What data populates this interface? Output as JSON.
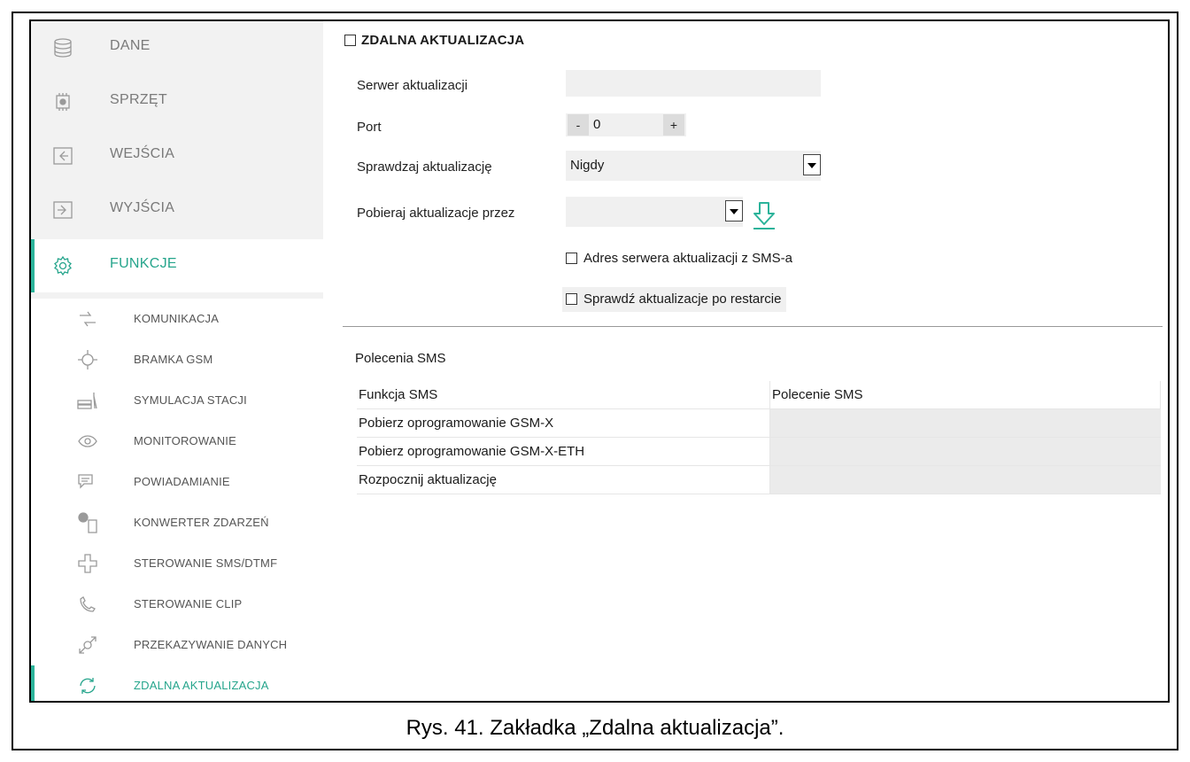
{
  "sidebar": {
    "main_items": [
      {
        "label": "DANE",
        "icon": "database-icon"
      },
      {
        "label": "SPRZĘT",
        "icon": "chip-icon"
      },
      {
        "label": "WEJŚCIA",
        "icon": "input-icon"
      },
      {
        "label": "WYJŚCIA",
        "icon": "output-icon"
      },
      {
        "label": "FUNKCJE",
        "icon": "gear-icon"
      }
    ],
    "sub_items": [
      {
        "label": "KOMUNIKACJA",
        "icon": "arrows-icon"
      },
      {
        "label": "BRAMKA GSM",
        "icon": "gsm-icon"
      },
      {
        "label": "SYMULACJA STACJI",
        "icon": "station-icon"
      },
      {
        "label": "MONITOROWANIE",
        "icon": "eye-icon"
      },
      {
        "label": "POWIADAMIANIE",
        "icon": "chat-icon"
      },
      {
        "label": "KONWERTER ZDARZEŃ",
        "icon": "converter-icon"
      },
      {
        "label": "STEROWANIE SMS/DTMF",
        "icon": "dpad-icon"
      },
      {
        "label": "STEROWANIE CLIP",
        "icon": "phone-icon"
      },
      {
        "label": "PRZEKAZYWANIE DANYCH",
        "icon": "transfer-icon"
      },
      {
        "label": "ZDALNA AKTUALIZACJA",
        "icon": "refresh-icon"
      }
    ],
    "accent_color": "#2bb39a"
  },
  "main": {
    "section_title": "ZDALNA AKTUALIZACJA",
    "fields": {
      "server_label": "Serwer aktualizacji",
      "server_value": "",
      "port_label": "Port",
      "port_minus": "-",
      "port_value": "0",
      "port_plus": "+",
      "check_label": "Sprawdzaj aktualizację",
      "check_value": "Nigdy",
      "download_label": "Pobieraj aktualizacje przez",
      "download_value": ""
    },
    "checkboxes": {
      "sms_address": "Adres serwera aktualizacji z SMS-a",
      "check_after_restart": "Sprawdź aktualizacje po restarcie"
    },
    "sms": {
      "title": "Polecenia SMS",
      "headers": [
        "Funkcja SMS",
        "Polecenie SMS"
      ],
      "rows": [
        {
          "function": "Pobierz oprogramowanie GSM-X",
          "command": ""
        },
        {
          "function": "Pobierz oprogramowanie GSM-X-ETH",
          "command": ""
        },
        {
          "function": "Rozpocznij aktualizację",
          "command": ""
        }
      ]
    }
  },
  "caption": "Rys. 41. Zakładka „Zdalna aktualizacja”."
}
